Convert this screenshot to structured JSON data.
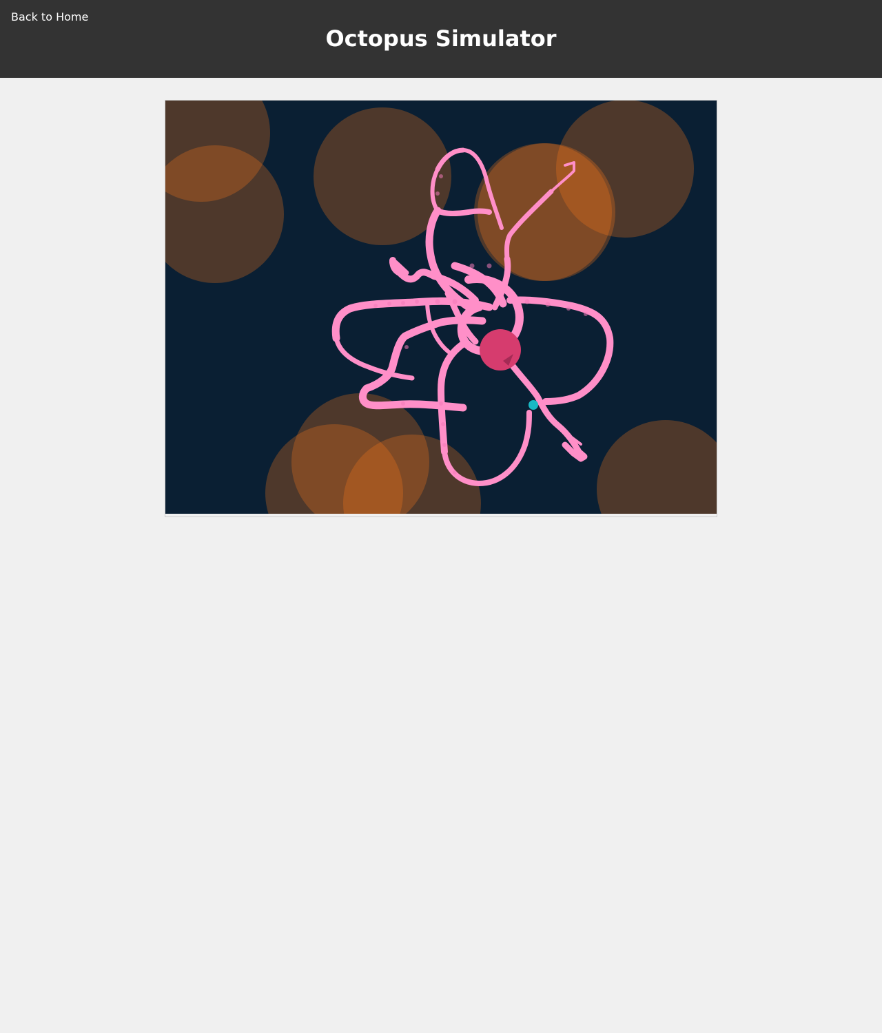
{
  "header": {
    "back_link": "Back to Home",
    "title": "Octopus Simulator"
  },
  "simulation": {
    "background_color": "#0a1f33",
    "light_color": "#ff7a1a",
    "octopus_color": "#ff8fc8",
    "head_color": "#d63c6e",
    "prey_color": "#19b8c4"
  }
}
